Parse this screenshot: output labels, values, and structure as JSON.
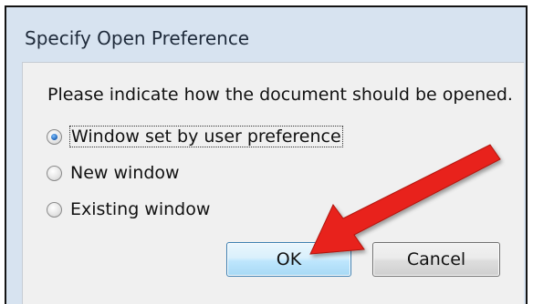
{
  "dialog": {
    "title": "Specify Open Preference",
    "prompt": "Please indicate how the document should be opened.",
    "options": [
      {
        "label": "Window set by user preference",
        "checked": true
      },
      {
        "label": "New window",
        "checked": false
      },
      {
        "label": "Existing window",
        "checked": false
      }
    ],
    "buttons": {
      "ok_label": "OK",
      "cancel_label": "Cancel"
    }
  },
  "annotation": {
    "arrow_color": "#e8231b",
    "points_to": "ok-button"
  },
  "colors": {
    "title_bar": "#d7e3f0",
    "content_bg": "#f0f0f0",
    "ok_border": "#3c7fb1"
  }
}
